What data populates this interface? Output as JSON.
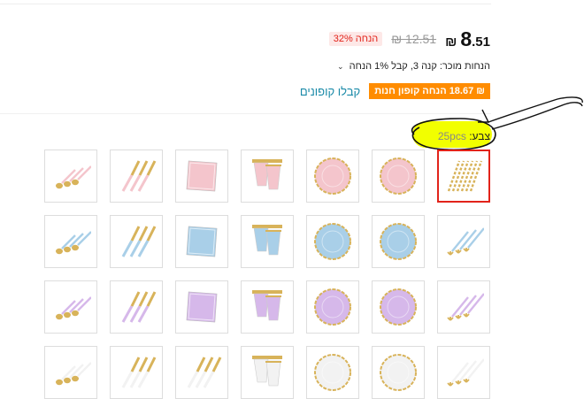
{
  "price": {
    "currency": "₪",
    "integer": "8",
    "decimal": ".51",
    "original": "₪ 12.51",
    "discount_label": "32% הנחה"
  },
  "seller_discount": "הנחות מוכר: קנה 3, קבל 1% הנחה",
  "coupon": {
    "badge": "₪ 18.67 הנחה קופון חנות",
    "link": "קבלו קופונים"
  },
  "color": {
    "label": "צבע:",
    "value": "25pcs"
  },
  "colors": {
    "highlight": "#f2ff00",
    "selected_border": "#e2231a",
    "coupon_orange": "#ff8c00",
    "link": "#1a8aa8"
  },
  "swatches": [
    [
      "straws-icon",
      "wavy-plate-icon",
      "wavy-plate-icon",
      "cups-icon",
      "napkin-icon",
      "knives-icon",
      "spoons-icon"
    ],
    [
      "forks-icon",
      "wavy-plate-icon",
      "wavy-plate-icon",
      "cups-icon",
      "napkin-icon",
      "knives-icon",
      "spoons-icon"
    ],
    [
      "forks-icon",
      "wavy-plate-icon",
      "wavy-plate-icon",
      "cups-icon",
      "napkin-icon",
      "knives-icon",
      "spoons-icon"
    ],
    [
      "forks-icon",
      "wavy-plate-icon",
      "wavy-plate-icon",
      "cups-icon",
      "knives-icon",
      "knives-icon",
      "spoons-icon"
    ]
  ],
  "row_colors": [
    "#f4c5cc",
    "#a9cfe8",
    "#d6b8ea",
    "#f2f2f2"
  ],
  "selected_swatch": 0
}
